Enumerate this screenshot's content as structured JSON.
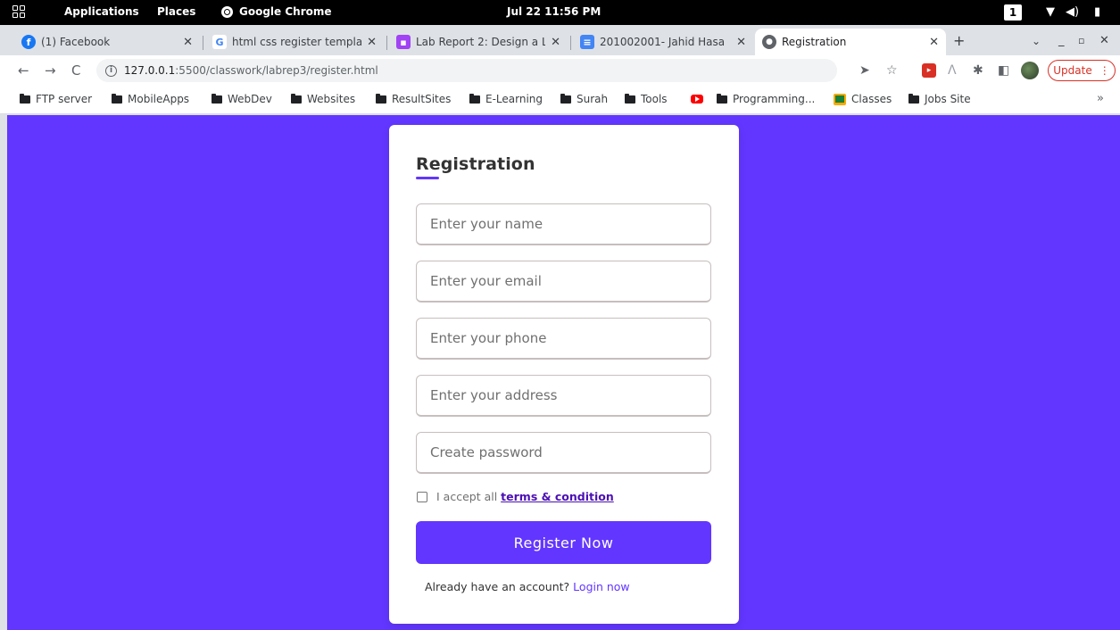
{
  "system_bar": {
    "activities": "Applications",
    "places": "Places",
    "app_name": "Google Chrome",
    "datetime": "Jul 22  11:56 PM",
    "workspace": "1"
  },
  "tabs": [
    {
      "title": "(1) Facebook",
      "favicon": "facebook-icon",
      "favicon_color": "#1877f2",
      "active": false
    },
    {
      "title": "html css register templa",
      "favicon": "google-icon",
      "favicon_color": "#4285f4",
      "active": false
    },
    {
      "title": "Lab Report 2: Design a L",
      "favicon": "classroom-icon",
      "favicon_color": "#a142f4",
      "active": false
    },
    {
      "title": "201002001- Jahid Hasa",
      "favicon": "docs-icon",
      "favicon_color": "#4285f4",
      "active": false
    },
    {
      "title": "Registration",
      "favicon": "globe-icon",
      "favicon_color": "#5f6368",
      "active": true
    }
  ],
  "address_bar": {
    "host": "127.0.0.1",
    "path": ":5500/classwork/labrep3/register.html",
    "update_label": "Update"
  },
  "bookmarks": [
    {
      "label": "FTP server",
      "icon": "folder-icon"
    },
    {
      "label": "MobileApps",
      "icon": "folder-icon"
    },
    {
      "label": "WebDev",
      "icon": "folder-icon"
    },
    {
      "label": "Websites",
      "icon": "folder-icon"
    },
    {
      "label": "ResultSites",
      "icon": "folder-icon"
    },
    {
      "label": "E-Learning",
      "icon": "folder-icon"
    },
    {
      "label": "Surah",
      "icon": "folder-icon"
    },
    {
      "label": "Tools",
      "icon": "folder-icon"
    },
    {
      "label": "",
      "icon": "youtube-icon"
    },
    {
      "label": "Programming...",
      "icon": "folder-icon"
    },
    {
      "label": "Classes",
      "icon": "classroom-icon"
    },
    {
      "label": "Jobs Site",
      "icon": "folder-icon"
    }
  ],
  "form": {
    "title": "Registration",
    "fields": {
      "name": {
        "placeholder": "Enter your name",
        "value": ""
      },
      "email": {
        "placeholder": "Enter your email",
        "value": ""
      },
      "phone": {
        "placeholder": "Enter your phone",
        "value": ""
      },
      "address": {
        "placeholder": "Enter your address",
        "value": ""
      },
      "password": {
        "placeholder": "Create password",
        "value": ""
      }
    },
    "terms_text": "I accept all",
    "terms_link": "terms & condition",
    "terms_checked": false,
    "submit_label": "Register Now",
    "login_prompt": "Already have an account?",
    "login_link": "Login now"
  },
  "colors": {
    "accent": "#6236ff",
    "link": "#4b0fb4"
  }
}
